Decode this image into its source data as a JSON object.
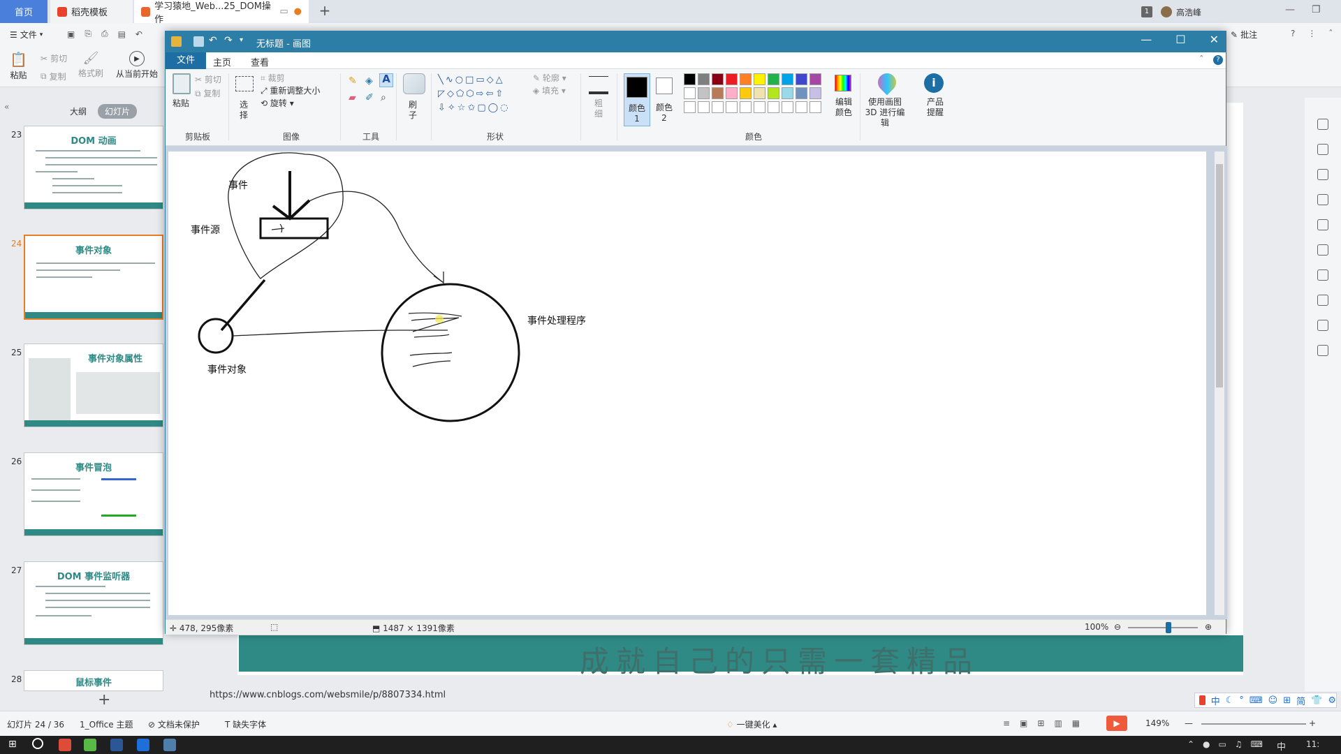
{
  "wps": {
    "tabs": {
      "home": "首页",
      "templates": "稻壳模板",
      "document": "学习猿地_Web...25_DOM操作"
    },
    "user": {
      "badge": "1",
      "name": "高浩峰"
    },
    "toolbar": {
      "file": "文件",
      "paste": "粘贴",
      "cut": "剪切",
      "copy": "复制",
      "format_painter": "格式刷",
      "play_from_current": "从当前开始",
      "comment": "批注"
    },
    "panel_tabs": {
      "outline": "大纲",
      "slides": "幻灯片"
    },
    "slides": [
      {
        "num": "23",
        "title": "DOM 动画"
      },
      {
        "num": "24",
        "title": "事件对象"
      },
      {
        "num": "25",
        "title": "事件对象属性"
      },
      {
        "num": "26",
        "title": "事件冒泡"
      },
      {
        "num": "27",
        "title": "DOM 事件监听器"
      },
      {
        "num": "28",
        "title": "鼠标事件"
      }
    ],
    "slide_footer_text": "成就自己的只需一套精品",
    "url_tooltip": "https://www.cnblogs.com/websmile/p/8807334.html",
    "status": {
      "slide_index": "幻灯片 24 / 36",
      "theme": "1_Office 主题",
      "protect": "文档未保护",
      "missing_font": "缺失字体",
      "beautify": "一键美化",
      "zoom": "149%"
    },
    "ime": {
      "mode": "中",
      "simplified": "简"
    },
    "clock": "11:"
  },
  "paint": {
    "title": "无标题 - 画图",
    "menu": {
      "file": "文件",
      "home": "主页",
      "view": "查看"
    },
    "ribbon": {
      "clipboard": {
        "label": "剪贴板",
        "paste": "粘贴",
        "cut": "剪切",
        "copy": "复制"
      },
      "image": {
        "label": "图像",
        "select": "选择",
        "crop": "裁剪",
        "resize": "重新调整大小",
        "rotate": "旋转"
      },
      "tools": {
        "label": "工具"
      },
      "brushes": "刷子",
      "shapes": {
        "label": "形状",
        "outline": "轮廓",
        "fill": "填充"
      },
      "size": "粗细",
      "colors": {
        "label": "颜色",
        "color1": "颜色 1",
        "color2": "颜色 2",
        "edit": "编辑颜色",
        "palette_row1": [
          "#000000",
          "#7f7f7f",
          "#880015",
          "#ed1c24",
          "#ff7f27",
          "#fff200",
          "#22b14c",
          "#00a2e8",
          "#3f48cc",
          "#a349a4"
        ],
        "palette_row2": [
          "#ffffff",
          "#c3c3c3",
          "#b97a57",
          "#ffaec9",
          "#ffc90e",
          "#efe4b0",
          "#b5e61d",
          "#99d9ea",
          "#7092be",
          "#c8bfe7"
        ],
        "palette_row3": [
          "#ffffff",
          "#ffffff",
          "#ffffff",
          "#ffffff",
          "#ffffff",
          "#ffffff",
          "#ffffff",
          "#ffffff",
          "#ffffff",
          "#ffffff"
        ]
      },
      "paint3d": "使用画图 3D 进行编辑",
      "product_tips": "产品提醒"
    },
    "canvas_labels": {
      "event": "事件",
      "event_source": "事件源",
      "event_handler": "事件处理程序",
      "event_object": "事件对象"
    },
    "status": {
      "cursor": "478, 295像素",
      "size": "1487 × 1391像素",
      "zoom": "100%"
    }
  }
}
